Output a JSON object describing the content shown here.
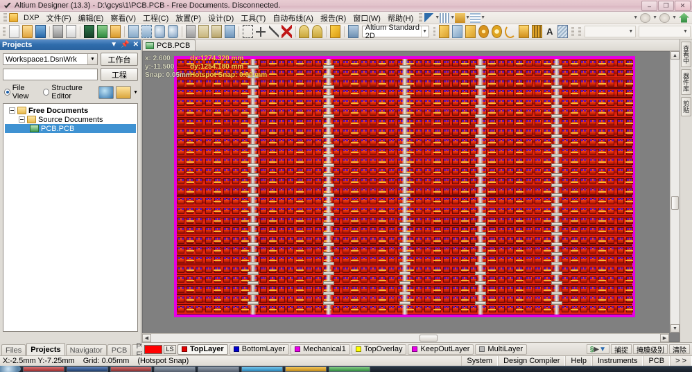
{
  "window": {
    "title": "Altium Designer (13.3) - D:\\gcys\\1\\PCB.PCB - Free Documents. Disconnected.",
    "icon": "altium-check-icon",
    "minimize": "–",
    "maximize": "❐",
    "close": "✕"
  },
  "menu": {
    "dxp": "DXP",
    "items": [
      {
        "label": "文件(F)",
        "name": "file"
      },
      {
        "label": "编辑(E)",
        "name": "edit"
      },
      {
        "label": "察看(V)",
        "name": "view"
      },
      {
        "label": "工程(C)",
        "name": "project"
      },
      {
        "label": "放置(P)",
        "name": "place"
      },
      {
        "label": "设计(D)",
        "name": "design"
      },
      {
        "label": "工具(T)",
        "name": "tools"
      },
      {
        "label": "自动布线(A)",
        "name": "autoroute"
      },
      {
        "label": "报告(R)",
        "name": "reports"
      },
      {
        "label": "窗口(W)",
        "name": "window"
      },
      {
        "label": "帮助(H)",
        "name": "help"
      }
    ]
  },
  "toolbar": {
    "view_config": "Altium Standard 2D",
    "dropdown_arrow": "▼",
    "buttons": [
      "new-document-icon",
      "open-folder-icon",
      "save-icon",
      "print-icon",
      "print-preview-icon",
      "board-3d-icon",
      "open-project-icon",
      "open-design-workspace-icon",
      "zoom-document-icon",
      "zoom-area-icon",
      "zoom-selected-icon",
      "zoom-filter-icon",
      "cut-icon",
      "copy-icon",
      "paste-icon",
      "rubber-stamp-icon",
      "select-area-icon",
      "move-icon",
      "deselect-icon",
      "clear-filter-icon",
      "undo-icon",
      "redo-icon",
      "highlight-pen-icon",
      "browse-library-icon"
    ],
    "draw_buttons": [
      "place-line-icon",
      "place-arc-icon",
      "place-polygon-icon",
      "place-via-icon",
      "place-pad-icon",
      "place-arc-center-icon",
      "place-fill-icon",
      "place-component-icon",
      "place-string-icon",
      "place-room-icon"
    ],
    "empty_combo_1": "",
    "empty_combo_2": ""
  },
  "projects_panel": {
    "title": "Projects",
    "menu_icon": "chevron-down-icon",
    "pin_icon": "pin-icon",
    "close_icon": "close-icon",
    "workspace_value": "Workspace1.DsnWrk",
    "project_value": "",
    "workbench_button": "工作台",
    "project_button": "工程",
    "file_view_label": "File View",
    "structure_editor_label": "Structure Editor",
    "selected_view": "File View",
    "tree": [
      {
        "label": "Free Documents",
        "icon": "folder-icon",
        "level": 0,
        "expanded": true,
        "selected": false,
        "bold": true
      },
      {
        "label": "Source Documents",
        "icon": "folder-icon",
        "level": 1,
        "expanded": true,
        "selected": false,
        "bold": false
      },
      {
        "label": "PCB.PCB",
        "icon": "pcb-document-icon",
        "level": 2,
        "expanded": null,
        "selected": true,
        "bold": false
      }
    ],
    "tabs": [
      {
        "label": "Files",
        "active": false
      },
      {
        "label": "Projects",
        "active": true
      },
      {
        "label": "Navigator",
        "active": false
      },
      {
        "label": "PCB",
        "active": false
      },
      {
        "label": "PCB Filter",
        "active": false
      }
    ]
  },
  "document_tabs": [
    {
      "label": "PCB.PCB",
      "icon": "pcb-document-icon",
      "active": true
    }
  ],
  "canvas_hud": {
    "x_label": "x:  2.600",
    "y_label": "y:-11.500",
    "snap_label": "Snap: 0.05mm",
    "dx_label": "dx:1274.320 mm",
    "dy_label": "dy:1254.180 mm",
    "hotspot_label": "Hotspot Snap: 0.00 mm"
  },
  "right_tabs": [
    {
      "label": "查看中"
    },
    {
      "label": "器件库"
    },
    {
      "label": "剪贴"
    }
  ],
  "layer_bar": {
    "active_color": "#ff0000",
    "count": "LS",
    "layers": [
      {
        "label": "TopLayer",
        "color": "#e00000",
        "active": true
      },
      {
        "label": "BottomLayer",
        "color": "#0000cc",
        "active": false
      },
      {
        "label": "Mechanical1",
        "color": "#e800e8",
        "active": false
      },
      {
        "label": "TopOverlay",
        "color": "#ffff00",
        "active": false
      },
      {
        "label": "KeepOutLayer",
        "color": "#e800e8",
        "active": false
      },
      {
        "label": "MultiLayer",
        "color": "#b8b8b8",
        "active": false
      }
    ],
    "right_buttons": [
      {
        "label": "捕捉",
        "name": "snap"
      },
      {
        "label": "掩膜级别",
        "name": "mask-level"
      },
      {
        "label": "清除",
        "name": "clear"
      }
    ],
    "mask_icon": "mask-filter-icon"
  },
  "status_bar": {
    "coordinates": "X:-2.5mm Y:-7.25mm",
    "grid": "Grid: 0.05mm",
    "hotspot": "(Hotspot Snap)",
    "right_items": [
      {
        "label": "System",
        "name": "system"
      },
      {
        "label": "Design Compiler",
        "name": "design-compiler"
      },
      {
        "label": "Help",
        "name": "help"
      },
      {
        "label": "Instruments",
        "name": "instruments"
      },
      {
        "label": "PCB",
        "name": "pcb"
      },
      {
        "label": "> >",
        "name": "more"
      }
    ]
  },
  "pcb_render": {
    "board_color": "#c00000",
    "keepout_color": "#e400e4",
    "canvas_bg": "#808080",
    "rows": 26,
    "bus_columns": 5
  }
}
